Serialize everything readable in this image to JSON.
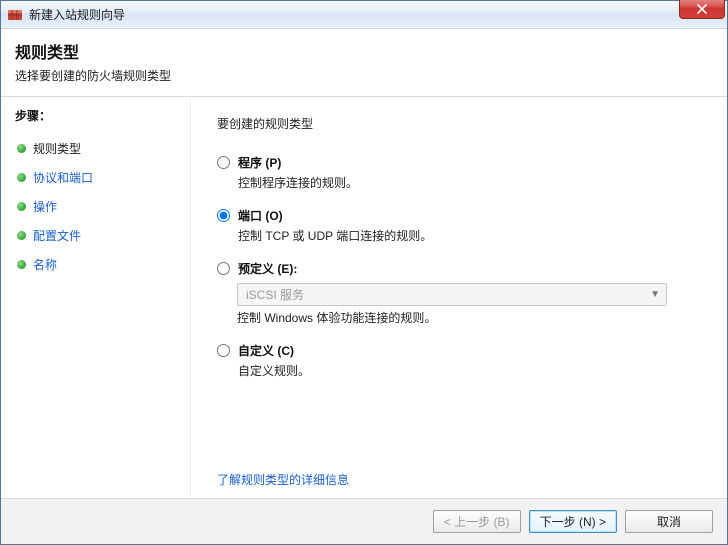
{
  "window": {
    "title": "新建入站规则向导"
  },
  "header": {
    "title": "规则类型",
    "subtitle": "选择要创建的防火墙规则类型"
  },
  "sidebar": {
    "steps_title": "步骤：",
    "items": [
      {
        "label": "规则类型",
        "state": "completed"
      },
      {
        "label": "协议和端口",
        "state": "active"
      },
      {
        "label": "操作",
        "state": "pending"
      },
      {
        "label": "配置文件",
        "state": "pending"
      },
      {
        "label": "名称",
        "state": "pending"
      }
    ]
  },
  "content": {
    "section_title": "要创建的规则类型",
    "options": [
      {
        "id": "program",
        "label": "程序 (P)",
        "desc": "控制程序连接的规则。",
        "selected": false
      },
      {
        "id": "port",
        "label": "端口 (O)",
        "desc": "控制 TCP 或 UDP 端口连接的规则。",
        "selected": true
      },
      {
        "id": "predef",
        "label": "预定义 (E):",
        "desc": "控制 Windows 体验功能连接的规则。",
        "selected": false,
        "select": {
          "value": "iSCSI 服务",
          "disabled": true
        }
      },
      {
        "id": "custom",
        "label": "自定义 (C)",
        "desc": "自定义规则。",
        "selected": false
      }
    ],
    "learn_more": "了解规则类型的详细信息"
  },
  "footer": {
    "back": "< 上一步 (B)",
    "next": "下一步 (N) >",
    "cancel": "取消"
  },
  "icons": {
    "close": "close-icon",
    "app": "firewall-icon",
    "chevron_down": "▼"
  }
}
